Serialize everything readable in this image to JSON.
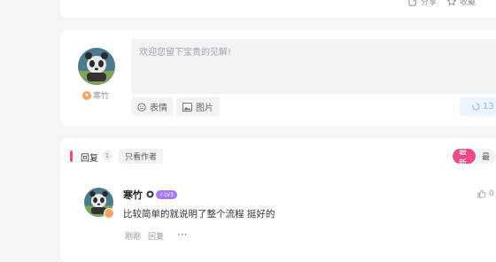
{
  "top_bar": {
    "share_label": "分享",
    "favorite_label": "收藏",
    "more_label": "···"
  },
  "comment_box": {
    "placeholder": "欢迎您留下宝贵的见解!",
    "emoji_label": "表情",
    "image_label": "图片",
    "submit_label": "13",
    "user_name": "寒竹"
  },
  "replies": {
    "title": "回复",
    "count": "1",
    "author_only_label": "只看作者",
    "sort_latest": "最新",
    "sort_hot": "最"
  },
  "reply_item": {
    "name": "寒竹",
    "level": "LV3",
    "content": "比较简单的就说明了整个流程 挺好的",
    "time": "刚刚",
    "reply_label": "回复",
    "more": "···",
    "likes": "0"
  },
  "colors": {
    "accent": "#ee4a8a",
    "level_badge": "#a57af5",
    "submit_bg": "#ecf4ff"
  }
}
